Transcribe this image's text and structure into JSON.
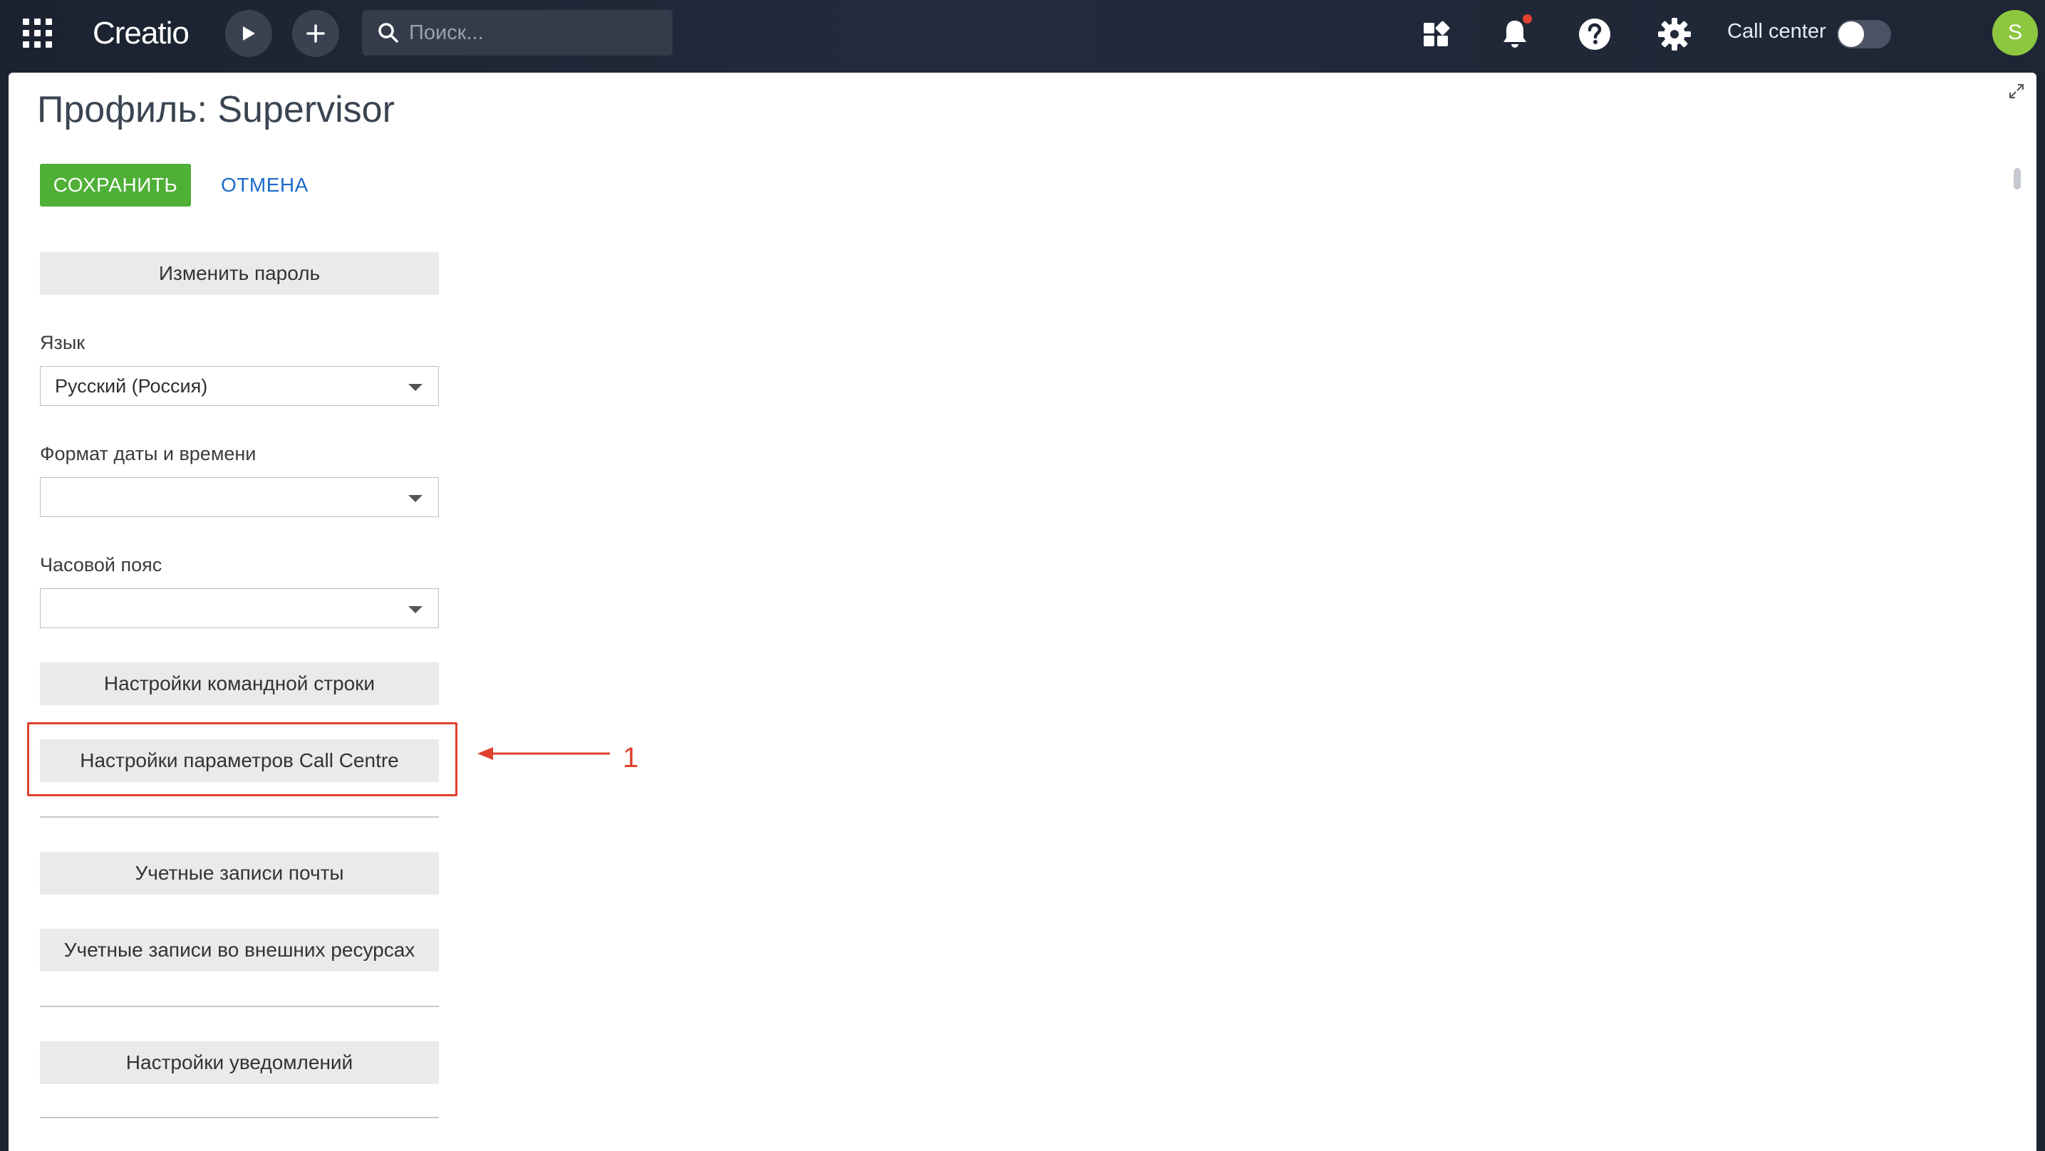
{
  "topbar": {
    "logo": "Creatio",
    "search_placeholder": "Поиск...",
    "call_center_label": "Call center",
    "call_center_enabled": false,
    "avatar_initial": "S",
    "notification_dot_color": "#e2422f",
    "avatar_color": "#8dc63f"
  },
  "page": {
    "title": "Профиль: Supervisor",
    "save_label": "СОХРАНИТЬ",
    "cancel_label": "ОТМЕНА",
    "change_password_label": "Изменить пароль",
    "language": {
      "label": "Язык",
      "value": "Русский (Россия)"
    },
    "datetime_format": {
      "label": "Формат даты и времени",
      "value": ""
    },
    "timezone": {
      "label": "Часовой пояс",
      "value": ""
    },
    "command_line_settings_label": "Настройки командной строки",
    "call_centre_settings_label": "Настройки параметров Call Centre",
    "email_accounts_label": "Учетные записи почты",
    "external_accounts_label": "Учетные записи во внешних ресурсах",
    "notification_settings_label": "Настройки уведомлений"
  },
  "annotation": {
    "number": "1",
    "color": "#e0412d"
  },
  "colors": {
    "save_button": "#4eb036",
    "cancel_link": "#1b6ac9"
  }
}
